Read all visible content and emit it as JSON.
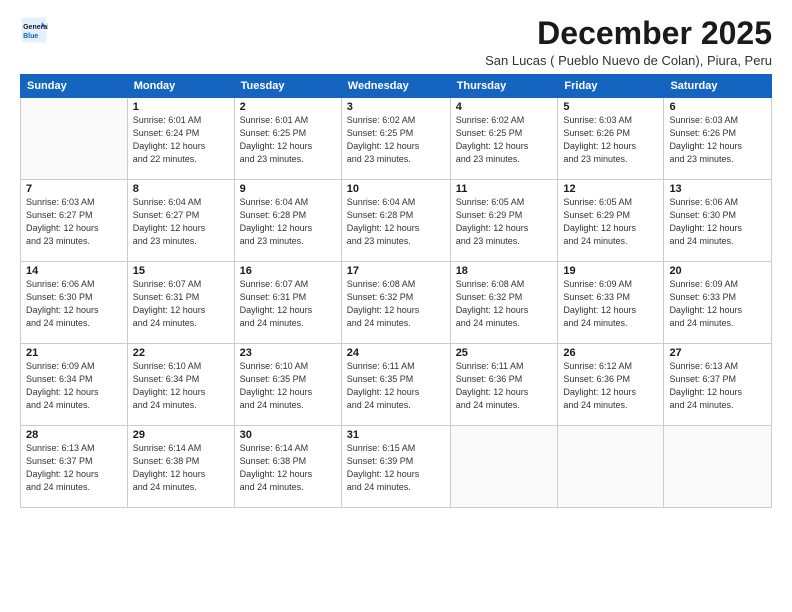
{
  "logo": {
    "line1": "General",
    "line2": "Blue"
  },
  "title": "December 2025",
  "subtitle": "San Lucas ( Pueblo Nuevo de Colan), Piura, Peru",
  "days_of_week": [
    "Sunday",
    "Monday",
    "Tuesday",
    "Wednesday",
    "Thursday",
    "Friday",
    "Saturday"
  ],
  "weeks": [
    [
      {
        "day": "",
        "info": ""
      },
      {
        "day": "1",
        "info": "Sunrise: 6:01 AM\nSunset: 6:24 PM\nDaylight: 12 hours\nand 22 minutes."
      },
      {
        "day": "2",
        "info": "Sunrise: 6:01 AM\nSunset: 6:25 PM\nDaylight: 12 hours\nand 23 minutes."
      },
      {
        "day": "3",
        "info": "Sunrise: 6:02 AM\nSunset: 6:25 PM\nDaylight: 12 hours\nand 23 minutes."
      },
      {
        "day": "4",
        "info": "Sunrise: 6:02 AM\nSunset: 6:25 PM\nDaylight: 12 hours\nand 23 minutes."
      },
      {
        "day": "5",
        "info": "Sunrise: 6:03 AM\nSunset: 6:26 PM\nDaylight: 12 hours\nand 23 minutes."
      },
      {
        "day": "6",
        "info": "Sunrise: 6:03 AM\nSunset: 6:26 PM\nDaylight: 12 hours\nand 23 minutes."
      }
    ],
    [
      {
        "day": "7",
        "info": "Sunrise: 6:03 AM\nSunset: 6:27 PM\nDaylight: 12 hours\nand 23 minutes."
      },
      {
        "day": "8",
        "info": "Sunrise: 6:04 AM\nSunset: 6:27 PM\nDaylight: 12 hours\nand 23 minutes."
      },
      {
        "day": "9",
        "info": "Sunrise: 6:04 AM\nSunset: 6:28 PM\nDaylight: 12 hours\nand 23 minutes."
      },
      {
        "day": "10",
        "info": "Sunrise: 6:04 AM\nSunset: 6:28 PM\nDaylight: 12 hours\nand 23 minutes."
      },
      {
        "day": "11",
        "info": "Sunrise: 6:05 AM\nSunset: 6:29 PM\nDaylight: 12 hours\nand 23 minutes."
      },
      {
        "day": "12",
        "info": "Sunrise: 6:05 AM\nSunset: 6:29 PM\nDaylight: 12 hours\nand 24 minutes."
      },
      {
        "day": "13",
        "info": "Sunrise: 6:06 AM\nSunset: 6:30 PM\nDaylight: 12 hours\nand 24 minutes."
      }
    ],
    [
      {
        "day": "14",
        "info": "Sunrise: 6:06 AM\nSunset: 6:30 PM\nDaylight: 12 hours\nand 24 minutes."
      },
      {
        "day": "15",
        "info": "Sunrise: 6:07 AM\nSunset: 6:31 PM\nDaylight: 12 hours\nand 24 minutes."
      },
      {
        "day": "16",
        "info": "Sunrise: 6:07 AM\nSunset: 6:31 PM\nDaylight: 12 hours\nand 24 minutes."
      },
      {
        "day": "17",
        "info": "Sunrise: 6:08 AM\nSunset: 6:32 PM\nDaylight: 12 hours\nand 24 minutes."
      },
      {
        "day": "18",
        "info": "Sunrise: 6:08 AM\nSunset: 6:32 PM\nDaylight: 12 hours\nand 24 minutes."
      },
      {
        "day": "19",
        "info": "Sunrise: 6:09 AM\nSunset: 6:33 PM\nDaylight: 12 hours\nand 24 minutes."
      },
      {
        "day": "20",
        "info": "Sunrise: 6:09 AM\nSunset: 6:33 PM\nDaylight: 12 hours\nand 24 minutes."
      }
    ],
    [
      {
        "day": "21",
        "info": "Sunrise: 6:09 AM\nSunset: 6:34 PM\nDaylight: 12 hours\nand 24 minutes."
      },
      {
        "day": "22",
        "info": "Sunrise: 6:10 AM\nSunset: 6:34 PM\nDaylight: 12 hours\nand 24 minutes."
      },
      {
        "day": "23",
        "info": "Sunrise: 6:10 AM\nSunset: 6:35 PM\nDaylight: 12 hours\nand 24 minutes."
      },
      {
        "day": "24",
        "info": "Sunrise: 6:11 AM\nSunset: 6:35 PM\nDaylight: 12 hours\nand 24 minutes."
      },
      {
        "day": "25",
        "info": "Sunrise: 6:11 AM\nSunset: 6:36 PM\nDaylight: 12 hours\nand 24 minutes."
      },
      {
        "day": "26",
        "info": "Sunrise: 6:12 AM\nSunset: 6:36 PM\nDaylight: 12 hours\nand 24 minutes."
      },
      {
        "day": "27",
        "info": "Sunrise: 6:13 AM\nSunset: 6:37 PM\nDaylight: 12 hours\nand 24 minutes."
      }
    ],
    [
      {
        "day": "28",
        "info": "Sunrise: 6:13 AM\nSunset: 6:37 PM\nDaylight: 12 hours\nand 24 minutes."
      },
      {
        "day": "29",
        "info": "Sunrise: 6:14 AM\nSunset: 6:38 PM\nDaylight: 12 hours\nand 24 minutes."
      },
      {
        "day": "30",
        "info": "Sunrise: 6:14 AM\nSunset: 6:38 PM\nDaylight: 12 hours\nand 24 minutes."
      },
      {
        "day": "31",
        "info": "Sunrise: 6:15 AM\nSunset: 6:39 PM\nDaylight: 12 hours\nand 24 minutes."
      },
      {
        "day": "",
        "info": ""
      },
      {
        "day": "",
        "info": ""
      },
      {
        "day": "",
        "info": ""
      }
    ]
  ]
}
